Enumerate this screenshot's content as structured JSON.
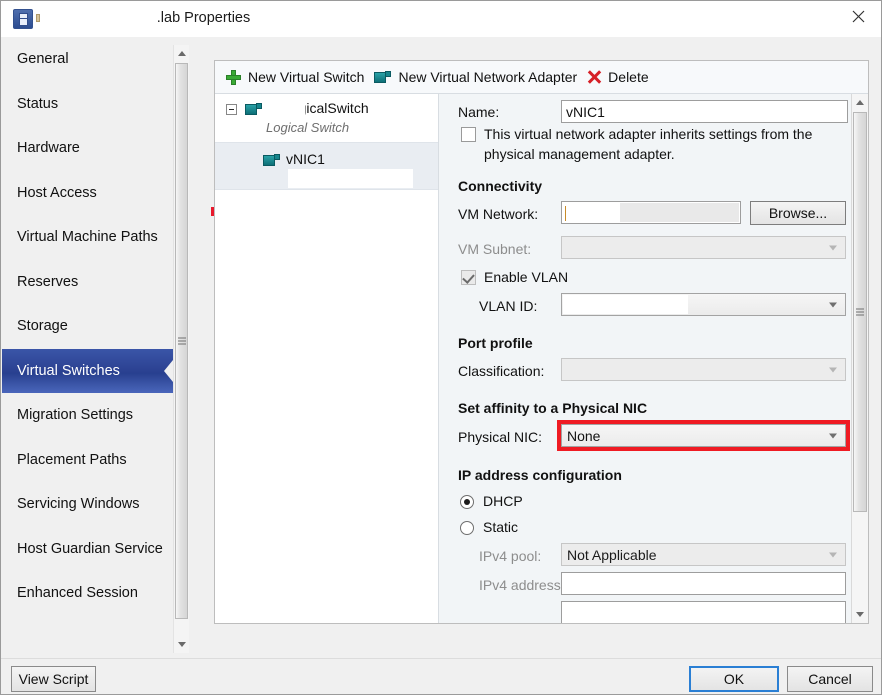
{
  "window": {
    "title": ".lab Properties",
    "icon": "properties-icon",
    "close_label": "✕"
  },
  "sidebar": {
    "items": [
      {
        "label": "General",
        "selected": false
      },
      {
        "label": "Status",
        "selected": false
      },
      {
        "label": "Hardware",
        "selected": false
      },
      {
        "label": "Host Access",
        "selected": false
      },
      {
        "label": "Virtual Machine Paths",
        "selected": false
      },
      {
        "label": "Reserves",
        "selected": false
      },
      {
        "label": "Storage",
        "selected": false
      },
      {
        "label": "Virtual Switches",
        "selected": true
      },
      {
        "label": "Migration Settings",
        "selected": false
      },
      {
        "label": "Placement Paths",
        "selected": false
      },
      {
        "label": "Servicing Windows",
        "selected": false
      },
      {
        "label": "Host Guardian Service",
        "selected": false
      },
      {
        "label": "Enhanced Session",
        "selected": false
      }
    ]
  },
  "toolbar": {
    "new_virtual_switch": "New Virtual Switch",
    "new_virtual_network_adapter": "New Virtual Network Adapter",
    "delete": "Delete"
  },
  "tree": {
    "root": {
      "label": "LogicalSwitch",
      "subtitle": "Logical Switch",
      "expanded": true
    },
    "child": {
      "label": "vNIC1",
      "selected": true
    }
  },
  "form": {
    "name_label": "Name:",
    "name_value": "vNIC1",
    "inherit_checkbox_label_line1": "This virtual network adapter inherits settings from the",
    "inherit_checkbox_label_line2": "physical management adapter.",
    "inherit_checked": false,
    "connectivity_header": "Connectivity",
    "vm_network_label": "VM Network:",
    "vm_network_value": "",
    "browse_label": "Browse...",
    "vm_subnet_label": "VM Subnet:",
    "vm_subnet_value": "",
    "vm_subnet_disabled": true,
    "enable_vlan_label": "Enable VLAN",
    "enable_vlan_checked": true,
    "vlan_id_label": "VLAN ID:",
    "vlan_id_value": "",
    "port_profile_header": "Port profile",
    "classification_label": "Classification:",
    "classification_value": "",
    "affinity_header": "Set affinity to a Physical NIC",
    "physical_nic_label": "Physical NIC:",
    "physical_nic_value": "None",
    "physical_nic_highlight_color": "#ef1b23",
    "ip_config_header": "IP address configuration",
    "dhcp_label": "DHCP",
    "static_label": "Static",
    "ip_mode_selected": "DHCP",
    "ipv4_pool_label": "IPv4 pool:",
    "ipv4_pool_value": "Not Applicable",
    "ipv4_address_label": "IPv4 address:",
    "ipv4_address_value": ""
  },
  "footer": {
    "view_script": "View Script",
    "ok": "OK",
    "cancel": "Cancel"
  }
}
